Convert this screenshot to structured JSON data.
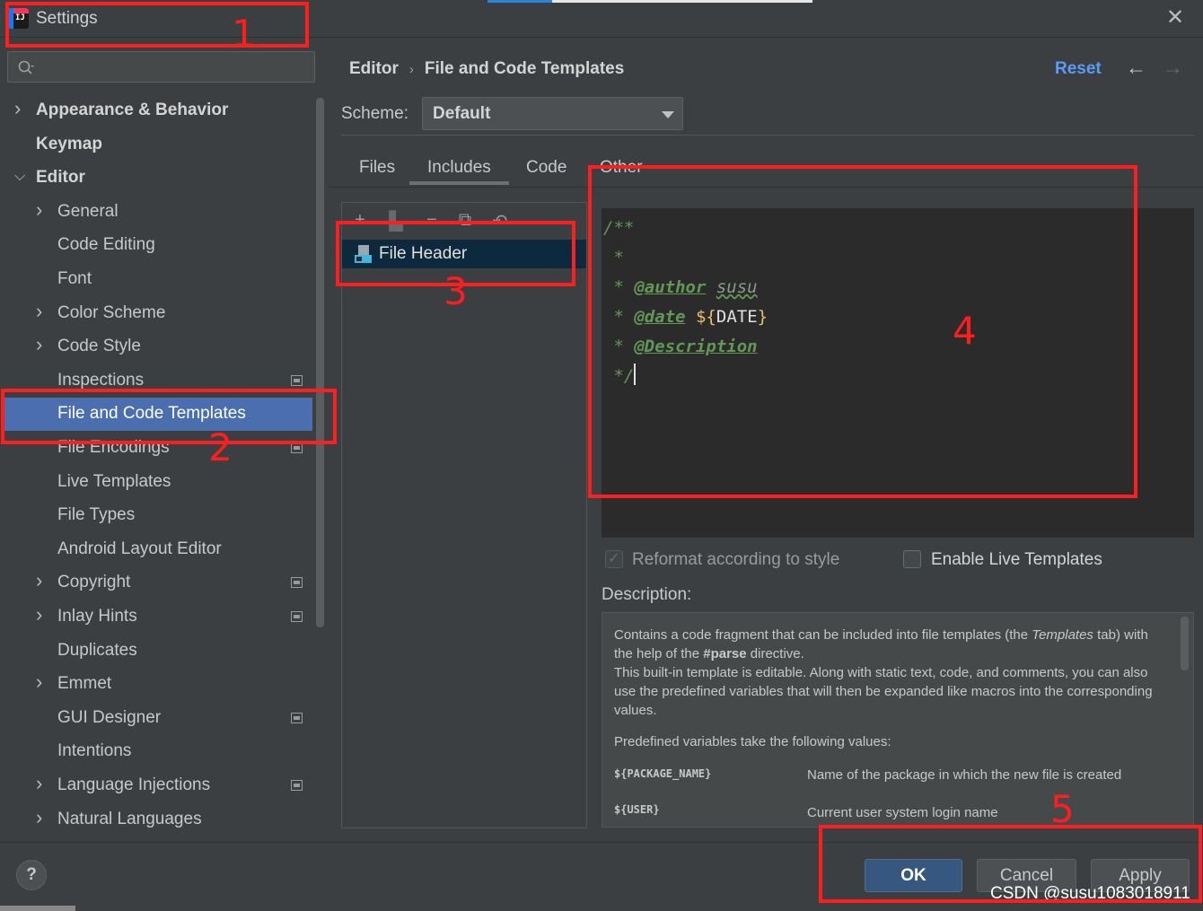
{
  "window": {
    "title": "Settings"
  },
  "sidebar": {
    "items": [
      {
        "label": "Appearance & Behavior",
        "level": 0,
        "arrow": "right",
        "bold": true
      },
      {
        "label": "Keymap",
        "level": 0,
        "arrow": "",
        "bold": true
      },
      {
        "label": "Editor",
        "level": 0,
        "arrow": "down",
        "bold": true
      },
      {
        "label": "General",
        "level": 1,
        "arrow": "right"
      },
      {
        "label": "Code Editing",
        "level": 1,
        "arrow": ""
      },
      {
        "label": "Font",
        "level": 1,
        "arrow": ""
      },
      {
        "label": "Color Scheme",
        "level": 1,
        "arrow": "right"
      },
      {
        "label": "Code Style",
        "level": 1,
        "arrow": "right"
      },
      {
        "label": "Inspections",
        "level": 1,
        "arrow": "",
        "project_icon": true
      },
      {
        "label": "File and Code Templates",
        "level": 1,
        "arrow": "",
        "selected": true
      },
      {
        "label": "File Encodings",
        "level": 1,
        "arrow": "",
        "project_icon": true
      },
      {
        "label": "Live Templates",
        "level": 1,
        "arrow": ""
      },
      {
        "label": "File Types",
        "level": 1,
        "arrow": ""
      },
      {
        "label": "Android Layout Editor",
        "level": 1,
        "arrow": ""
      },
      {
        "label": "Copyright",
        "level": 1,
        "arrow": "right",
        "project_icon": true
      },
      {
        "label": "Inlay Hints",
        "level": 1,
        "arrow": "right",
        "project_icon": true
      },
      {
        "label": "Duplicates",
        "level": 1,
        "arrow": ""
      },
      {
        "label": "Emmet",
        "level": 1,
        "arrow": "right"
      },
      {
        "label": "GUI Designer",
        "level": 1,
        "arrow": "",
        "project_icon": true
      },
      {
        "label": "Intentions",
        "level": 1,
        "arrow": ""
      },
      {
        "label": "Language Injections",
        "level": 1,
        "arrow": "right",
        "project_icon": true
      },
      {
        "label": "Natural Languages",
        "level": 1,
        "arrow": "right"
      }
    ]
  },
  "header": {
    "breadcrumb_parent": "Editor",
    "breadcrumb_current": "File and Code Templates",
    "reset": "Reset"
  },
  "scheme": {
    "label": "Scheme:",
    "value": "Default"
  },
  "tabs": [
    "Files",
    "Includes",
    "Code",
    "Other"
  ],
  "template_list": {
    "items": [
      "File Header"
    ]
  },
  "editor": {
    "lines": {
      "l1": "/**",
      "l2": " *",
      "l3_prefix": " * ",
      "l3_tag": "@author",
      "l3_value": "susu",
      "l4_prefix": " * ",
      "l4_tag": "@date",
      "l4_open": "${",
      "l4_var": "DATE",
      "l4_close": "}",
      "l5_prefix": " * ",
      "l5_tag": "@Description",
      "l6": " */"
    }
  },
  "options": {
    "reformat": {
      "label": "Reformat according to style",
      "checked": true
    },
    "live_templates": {
      "label": "Enable Live Templates",
      "checked": false
    }
  },
  "description": {
    "label": "Description:",
    "p1_a": "Contains a code fragment that can be included into file templates (the ",
    "p1_i": "Templates",
    "p1_b": " tab) with the help of the ",
    "p1_bold": "#parse",
    "p1_c": " directive.",
    "p2": "This built-in template is editable. Along with static text, code, and comments, you can also use the predefined variables that will then be expanded like macros into the corresponding values.",
    "p3": "Predefined variables take the following values:",
    "vars": [
      {
        "name": "${PACKAGE_NAME}",
        "desc": "Name of the package in which the new file is created"
      },
      {
        "name": "${USER}",
        "desc": "Current user system login name"
      }
    ]
  },
  "footer": {
    "help": "?",
    "ok": "OK",
    "cancel": "Cancel",
    "apply": "Apply",
    "watermark": "CSDN @susu1083018911"
  },
  "annotations": [
    "1",
    "2",
    "3",
    "4",
    "5"
  ],
  "colors": {
    "accent": "#4b6eaf",
    "link": "#589df6",
    "annotation": "#ff1e1e",
    "comment_green": "#629755"
  }
}
